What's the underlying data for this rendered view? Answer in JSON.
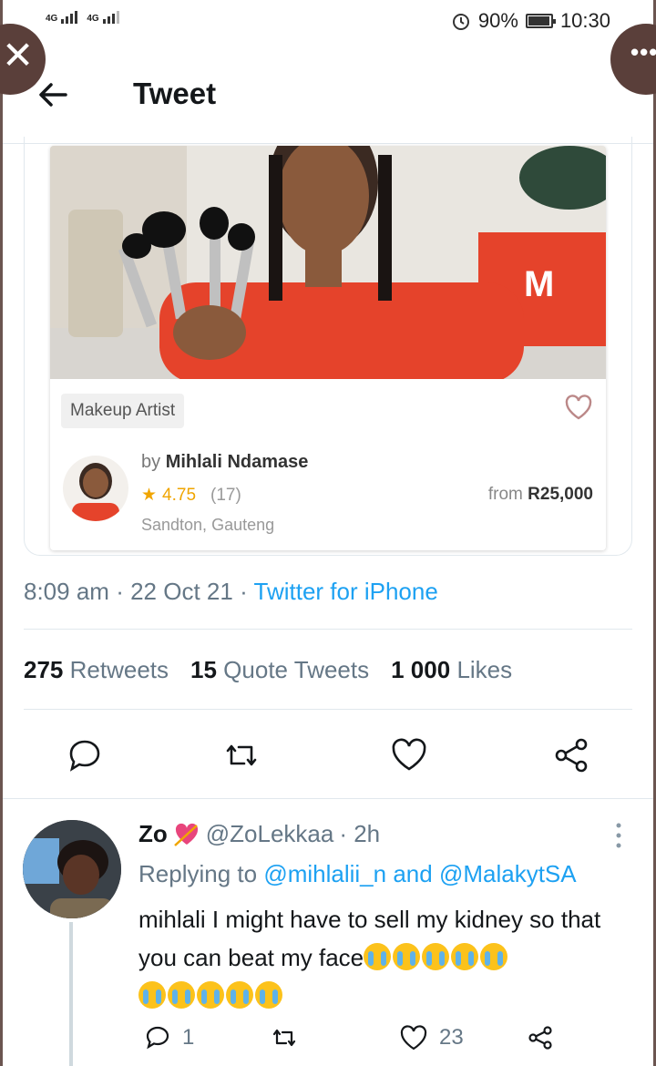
{
  "status_bar": {
    "network_1": "4G",
    "network_2": "4G",
    "battery": "90%",
    "time": "10:30"
  },
  "header": {
    "title": "Tweet"
  },
  "listing_card": {
    "category": "Makeup Artist",
    "by_prefix": "by",
    "artist_name": "Mihlali Ndamase",
    "rating": "4.75",
    "review_count": "(17)",
    "location": "Sandton, Gauteng",
    "price_prefix": "from",
    "price": "R25,000"
  },
  "tweet_meta": {
    "time": "8:09 am",
    "date": "22 Oct 21",
    "separator": "·",
    "source": "Twitter for iPhone"
  },
  "tweet_counts": {
    "retweets_num": "275",
    "retweets_label": "Retweets",
    "quotes_num": "15",
    "quotes_label": "Quote Tweets",
    "likes_num": "1 000",
    "likes_label": "Likes"
  },
  "reply": {
    "name": "Zo",
    "handle": "@ZoLekkaa",
    "time": "· 2h",
    "replying_prefix": "Replying to",
    "mention_1": "@mihlalii_n",
    "and_word": "and",
    "mention_2": "@MalakytSA",
    "text": "mihlali I might have to sell my kidney so that you can beat my face",
    "reply_count": "1",
    "like_count": "23"
  },
  "colors": {
    "accent": "#1da1f2",
    "muted": "#657786",
    "text": "#14171a",
    "card_red": "#e5432b",
    "star": "#f0a500"
  },
  "icons": {
    "back": "arrow-left-icon",
    "reply": "comment-icon",
    "retweet": "retweet-icon",
    "like": "heart-icon",
    "share": "share-icon"
  }
}
